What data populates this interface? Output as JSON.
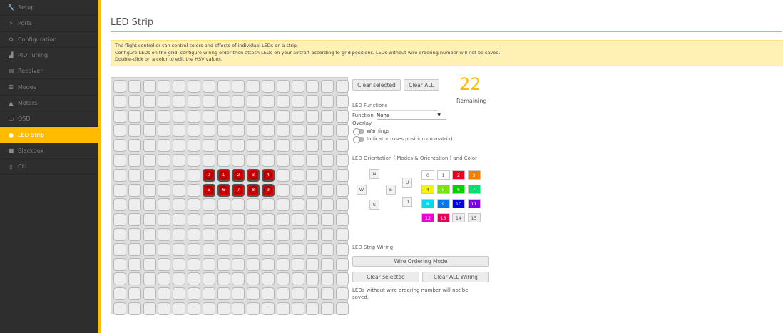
{
  "sidebar": {
    "items": [
      {
        "icon": "wrench-icon",
        "glyph": "🔧",
        "label": "Setup"
      },
      {
        "icon": "plug-icon",
        "glyph": "⚡",
        "label": "Ports"
      },
      {
        "icon": "gear-icon",
        "glyph": "⚙",
        "label": "Configuration"
      },
      {
        "icon": "bar-chart-icon",
        "glyph": "▟",
        "label": "PID Tuning"
      },
      {
        "icon": "receiver-icon",
        "glyph": "▤",
        "label": "Receiver"
      },
      {
        "icon": "modes-icon",
        "glyph": "☰",
        "label": "Modes"
      },
      {
        "icon": "motor-icon",
        "glyph": "▲",
        "label": "Motors"
      },
      {
        "icon": "osd-icon",
        "glyph": "▭",
        "label": "OSD"
      },
      {
        "icon": "led-icon",
        "glyph": "●",
        "label": "LED Strip"
      },
      {
        "icon": "blackbox-icon",
        "glyph": "■",
        "label": "Blackbox"
      },
      {
        "icon": "cli-icon",
        "glyph": "▯",
        "label": "CLI"
      }
    ],
    "active_index": 8
  },
  "page": {
    "title": "LED Strip",
    "note_lines": [
      "The flight controller can control colors and effects of individual LEDs on a strip.",
      "Configure LEDs on the grid, configure wiring order then attach LEDs on your aircraft according to grid positions. LEDs without wire ordering number will not be saved.",
      "Double-click on a color to edit the HSV values."
    ]
  },
  "grid": {
    "rows": 16,
    "cols": 16,
    "leds": [
      {
        "row": 6,
        "col": 6,
        "label": "0"
      },
      {
        "row": 6,
        "col": 7,
        "label": "1"
      },
      {
        "row": 6,
        "col": 8,
        "label": "2"
      },
      {
        "row": 6,
        "col": 9,
        "label": "3"
      },
      {
        "row": 6,
        "col": 10,
        "label": "4"
      },
      {
        "row": 7,
        "col": 6,
        "label": "5"
      },
      {
        "row": 7,
        "col": 7,
        "label": "6"
      },
      {
        "row": 7,
        "col": 8,
        "label": "7"
      },
      {
        "row": 7,
        "col": 9,
        "label": "8"
      },
      {
        "row": 7,
        "col": 10,
        "label": "9"
      }
    ]
  },
  "panel": {
    "clear_selected_label": "Clear selected",
    "clear_all_label": "Clear ALL",
    "remaining_count": "22",
    "remaining_label": "Remaining",
    "led_functions_title": "LED Functions",
    "function_label": "Function",
    "function_value": "None",
    "overlay_label": "Overlay",
    "warnings_label": "Warnings",
    "indicator_label": "Indicator (uses position on matrix)",
    "orientation_title": "LED Orientation ('Modes & Orientation') and Color",
    "directions": [
      "N",
      "W",
      "E",
      "S",
      "U",
      "D"
    ],
    "colors": [
      {
        "label": "0",
        "hex": "#ffffff"
      },
      {
        "label": "1",
        "hex": "#ffffff"
      },
      {
        "label": "2",
        "hex": "#e8001c"
      },
      {
        "label": "3",
        "hex": "#f07f00"
      },
      {
        "label": "4",
        "hex": "#f5f500"
      },
      {
        "label": "5",
        "hex": "#79e600"
      },
      {
        "label": "6",
        "hex": "#00d000"
      },
      {
        "label": "7",
        "hex": "#00e06e"
      },
      {
        "label": "8",
        "hex": "#00d9ef"
      },
      {
        "label": "9",
        "hex": "#0077f0"
      },
      {
        "label": "10",
        "hex": "#0000e6"
      },
      {
        "label": "11",
        "hex": "#7a00e6"
      },
      {
        "label": "12",
        "hex": "#ee00d8"
      },
      {
        "label": "13",
        "hex": "#e8005d"
      },
      {
        "label": "14",
        "hex": "#ececec"
      },
      {
        "label": "15",
        "hex": "#ececec"
      }
    ],
    "wiring_title": "LED Strip Wiring",
    "wire_ordering_label": "Wire Ordering Mode",
    "wiring_clear_selected_label": "Clear selected",
    "clear_all_wiring_label": "Clear ALL Wiring",
    "wiring_note": "LEDs without wire ordering number will not be saved."
  },
  "colors": {
    "accent": "#ffbb00",
    "sidebar_bg": "#2e2e2e",
    "note_bg": "#fff0b3",
    "led": "#d80000"
  }
}
